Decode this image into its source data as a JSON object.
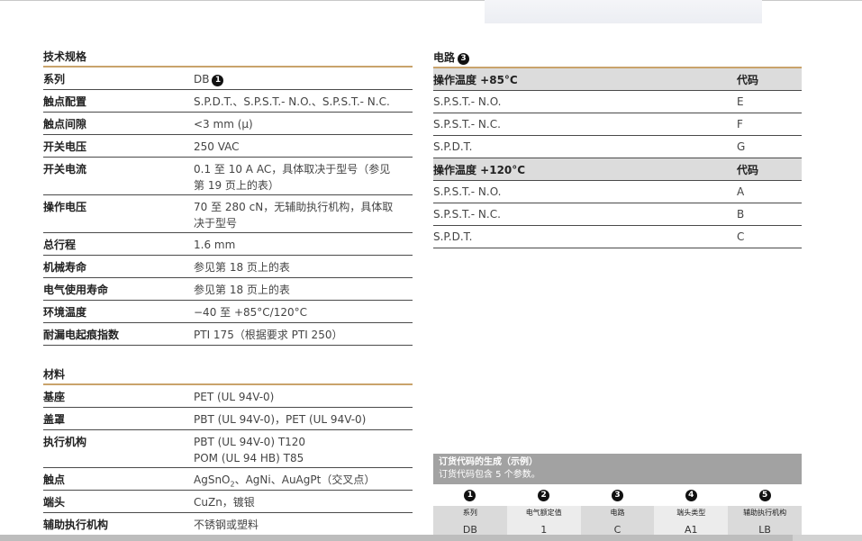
{
  "specs": {
    "title": "技术规格",
    "rows": [
      {
        "label": "系列",
        "value": "DB",
        "badge": "1"
      },
      {
        "label": "触点配置",
        "value": "S.P.D.T.、S.P.S.T.- N.O.、S.P.S.T.- N.C."
      },
      {
        "label": "触点间隙",
        "value": "<3 mm (μ)"
      },
      {
        "label": "开关电压",
        "value": "250 VAC"
      },
      {
        "label": "开关电流",
        "value_lines": [
          "0.1 至 10 A AC，具体取决于型号（参见",
          "第 19 页上的表）"
        ]
      },
      {
        "label": "操作电压",
        "value_lines": [
          "70 至 280 cN，无辅助执行机构，具体取",
          "决于型号"
        ]
      },
      {
        "label": "总行程",
        "value": "1.6 mm"
      },
      {
        "label": "机械寿命",
        "value": "参见第 18 页上的表"
      },
      {
        "label": "电气使用寿命",
        "value": "参见第 18 页上的表"
      },
      {
        "label": "环境温度",
        "value": "−40 至 +85°C/120°C"
      },
      {
        "label": "耐漏电起痕指数",
        "value": "PTI 175（根据要求 PTI 250）"
      }
    ]
  },
  "materials": {
    "title": "材料",
    "rows": [
      {
        "label": "基座",
        "value": "PET (UL 94V-0)"
      },
      {
        "label": "盖罩",
        "value": "PBT (UL 94V-0)，PET (UL 94V-0)"
      },
      {
        "label": "执行机构",
        "value_lines": [
          "PBT (UL 94V-0) T120",
          "POM (UL 94 HB) T85"
        ]
      },
      {
        "label": "触点",
        "value_pre": "AgSnO",
        "value_sub": "2",
        "value_post": "、AgNi、AuAgPt（交叉点）"
      },
      {
        "label": "端头",
        "value": "CuZn，镀银"
      },
      {
        "label": "辅助执行机构",
        "value": "不锈钢或塑料"
      }
    ]
  },
  "circuit": {
    "title": "电路",
    "badge": "3",
    "groups": [
      {
        "header": "操作温度 +85°C",
        "code_header": "代码",
        "rows": [
          {
            "type": "S.P.S.T.- N.O.",
            "code": "E"
          },
          {
            "type": "S.P.S.T.- N.C.",
            "code": "F"
          },
          {
            "type": "S.P.D.T.",
            "code": "G"
          }
        ]
      },
      {
        "header": "操作温度 +120°C",
        "code_header": "代码",
        "rows": [
          {
            "type": "S.P.S.T.- N.O.",
            "code": "A"
          },
          {
            "type": "S.P.S.T.- N.C.",
            "code": "B"
          },
          {
            "type": "S.P.D.T.",
            "code": "C"
          }
        ]
      }
    ]
  },
  "order_code": {
    "title": "订货代码的生成（示例）",
    "subtitle": "订货代码包含 5 个参数。",
    "columns": [
      {
        "num": "1",
        "label": "系列",
        "value": "DB"
      },
      {
        "num": "2",
        "label": "电气额定值",
        "value": "1"
      },
      {
        "num": "3",
        "label": "电路",
        "value": "C"
      },
      {
        "num": "4",
        "label": "端头类型",
        "value": "A1"
      },
      {
        "num": "5",
        "label": "辅助执行机构",
        "value": "LB"
      }
    ]
  },
  "colors": {
    "accent_rule": "#c9a36b",
    "header_fill": "#dcdcdc",
    "order_box": "#a2a2a2"
  }
}
